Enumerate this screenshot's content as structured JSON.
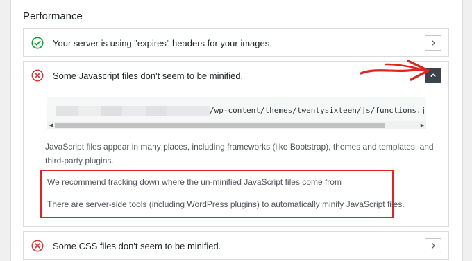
{
  "section": {
    "title": "Performance"
  },
  "items": [
    {
      "status": "pass",
      "icon": "check-circle-icon",
      "label": "Your server is using \"expires\" headers for your images.",
      "expanded": false
    },
    {
      "status": "fail",
      "icon": "x-circle-icon",
      "label": "Some Javascript files don't seem to be minified.",
      "expanded": true,
      "detail": {
        "code_path": "/wp-content/themes/twentysixteen/js/functions.js?ver=",
        "description": "JavaScript files appear in many places, including frameworks (like Bootstrap), themes and templates, and third-party plugins.",
        "recommendation_1": "We recommend tracking down where the un-minified JavaScript files come from",
        "recommendation_2": "There are server-side tools (including WordPress plugins) to automatically minify JavaScript files."
      }
    },
    {
      "status": "fail",
      "icon": "x-circle-icon",
      "label": "Some CSS files don't seem to be minified.",
      "expanded": false
    }
  ],
  "colors": {
    "pass": "#00a32a",
    "fail": "#d63638",
    "annotation": "#e02424",
    "active_button": "#3c434a"
  }
}
